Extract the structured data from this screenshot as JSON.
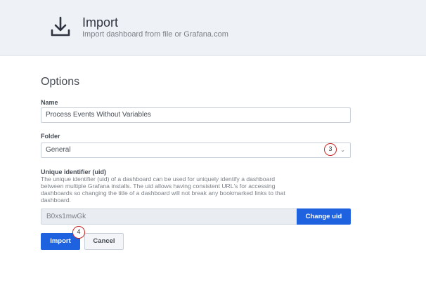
{
  "header": {
    "title": "Import",
    "subtitle": "Import dashboard from file or Grafana.com",
    "icon": "download-icon"
  },
  "options": {
    "title": "Options",
    "name": {
      "label": "Name",
      "value": "Process Events Without Variables"
    },
    "folder": {
      "label": "Folder",
      "value": "General"
    },
    "uid": {
      "label": "Unique identifier (uid)",
      "description": "The unique identifier (uid) of a dashboard can be used for uniquely identify a dashboard between multiple Grafana installs. The uid allows having consistent URL's for accessing dashboards so changing the title of a dashboard will not break any bookmarked links to that dashboard.",
      "value": "B0xs1mwGk",
      "change_label": "Change uid"
    }
  },
  "actions": {
    "import_label": "Import",
    "cancel_label": "Cancel"
  },
  "annotations": {
    "step3": "3",
    "step4": "4"
  },
  "colors": {
    "primary": "#1f62e0",
    "header_bg": "#eef1f5",
    "annotation": "#c62828"
  }
}
